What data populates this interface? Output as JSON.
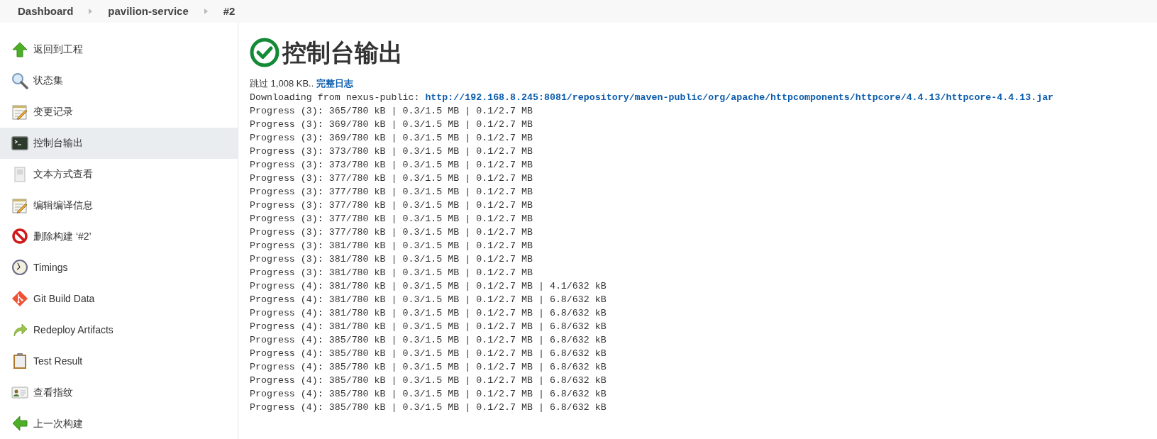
{
  "breadcrumbs": [
    {
      "label": "Dashboard"
    },
    {
      "label": "pavilion-service"
    },
    {
      "label": "#2"
    }
  ],
  "sidebar": {
    "items": [
      {
        "label": "返回到工程",
        "selected": false
      },
      {
        "label": "状态集",
        "selected": false
      },
      {
        "label": "变更记录",
        "selected": false
      },
      {
        "label": "控制台输出",
        "selected": true
      },
      {
        "label": "文本方式查看",
        "selected": false
      },
      {
        "label": "编辑编译信息",
        "selected": false
      },
      {
        "label": "删除构建 ‘#2’",
        "selected": false
      },
      {
        "label": "Timings",
        "selected": false
      },
      {
        "label": "Git Build Data",
        "selected": false
      },
      {
        "label": "Redeploy Artifacts",
        "selected": false
      },
      {
        "label": "Test Result",
        "selected": false
      },
      {
        "label": "查看指纹",
        "selected": false
      },
      {
        "label": "上一次构建",
        "selected": false
      }
    ]
  },
  "heading": "控制台输出",
  "skipped": "跳过 1,008 KB..",
  "full_log_link": "完整日志",
  "console": [
    {
      "kind": "download",
      "text": "Downloading from nexus-public: ",
      "link": "http://192.168.8.245:8081/repository/maven-public/org/apache/httpcomponents/httpcore/4.4.13/httpcore-4.4.13.jar"
    },
    {
      "kind": "text",
      "text": "Progress (3): 365/780 kB | 0.3/1.5 MB | 0.1/2.7 MB"
    },
    {
      "kind": "text",
      "text": "Progress (3): 369/780 kB | 0.3/1.5 MB | 0.1/2.7 MB"
    },
    {
      "kind": "text",
      "text": "Progress (3): 369/780 kB | 0.3/1.5 MB | 0.1/2.7 MB"
    },
    {
      "kind": "text",
      "text": "Progress (3): 373/780 kB | 0.3/1.5 MB | 0.1/2.7 MB"
    },
    {
      "kind": "text",
      "text": "Progress (3): 373/780 kB | 0.3/1.5 MB | 0.1/2.7 MB"
    },
    {
      "kind": "text",
      "text": "Progress (3): 377/780 kB | 0.3/1.5 MB | 0.1/2.7 MB"
    },
    {
      "kind": "text",
      "text": "Progress (3): 377/780 kB | 0.3/1.5 MB | 0.1/2.7 MB"
    },
    {
      "kind": "text",
      "text": "Progress (3): 377/780 kB | 0.3/1.5 MB | 0.1/2.7 MB"
    },
    {
      "kind": "text",
      "text": "Progress (3): 377/780 kB | 0.3/1.5 MB | 0.1/2.7 MB"
    },
    {
      "kind": "text",
      "text": "Progress (3): 377/780 kB | 0.3/1.5 MB | 0.1/2.7 MB"
    },
    {
      "kind": "text",
      "text": "Progress (3): 381/780 kB | 0.3/1.5 MB | 0.1/2.7 MB"
    },
    {
      "kind": "text",
      "text": "Progress (3): 381/780 kB | 0.3/1.5 MB | 0.1/2.7 MB"
    },
    {
      "kind": "text",
      "text": "Progress (3): 381/780 kB | 0.3/1.5 MB | 0.1/2.7 MB"
    },
    {
      "kind": "text",
      "text": "Progress (4): 381/780 kB | 0.3/1.5 MB | 0.1/2.7 MB | 4.1/632 kB"
    },
    {
      "kind": "text",
      "text": "Progress (4): 381/780 kB | 0.3/1.5 MB | 0.1/2.7 MB | 6.8/632 kB"
    },
    {
      "kind": "text",
      "text": "Progress (4): 381/780 kB | 0.3/1.5 MB | 0.1/2.7 MB | 6.8/632 kB"
    },
    {
      "kind": "text",
      "text": "Progress (4): 381/780 kB | 0.3/1.5 MB | 0.1/2.7 MB | 6.8/632 kB"
    },
    {
      "kind": "text",
      "text": "Progress (4): 385/780 kB | 0.3/1.5 MB | 0.1/2.7 MB | 6.8/632 kB"
    },
    {
      "kind": "text",
      "text": "Progress (4): 385/780 kB | 0.3/1.5 MB | 0.1/2.7 MB | 6.8/632 kB"
    },
    {
      "kind": "text",
      "text": "Progress (4): 385/780 kB | 0.3/1.5 MB | 0.1/2.7 MB | 6.8/632 kB"
    },
    {
      "kind": "text",
      "text": "Progress (4): 385/780 kB | 0.3/1.5 MB | 0.1/2.7 MB | 6.8/632 kB"
    },
    {
      "kind": "text",
      "text": "Progress (4): 385/780 kB | 0.3/1.5 MB | 0.1/2.7 MB | 6.8/632 kB"
    },
    {
      "kind": "text",
      "text": "Progress (4): 385/780 kB | 0.3/1.5 MB | 0.1/2.7 MB | 6.8/632 kB"
    }
  ]
}
